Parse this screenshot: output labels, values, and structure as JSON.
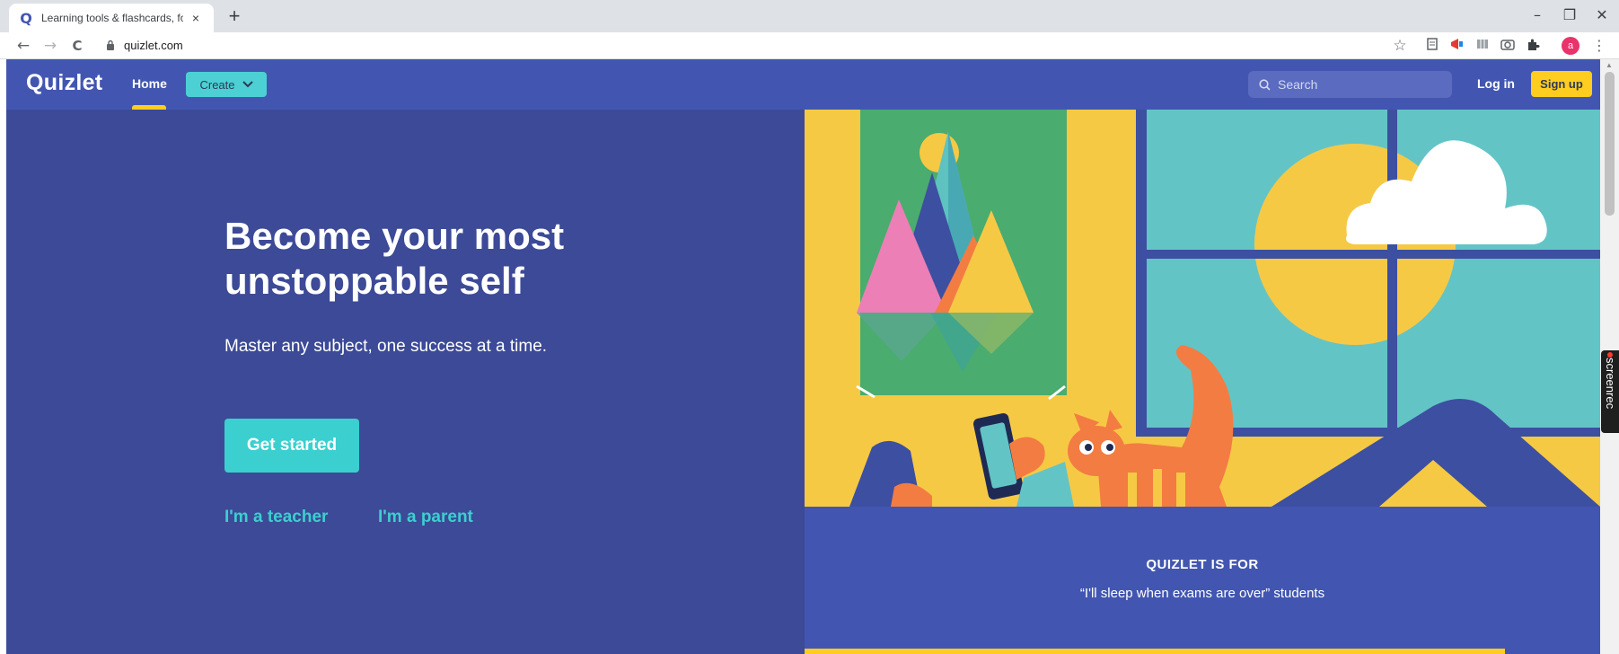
{
  "browser": {
    "tab_title": "Learning tools & flashcards, for free",
    "tab_favicon": "Q",
    "tab_close": "×",
    "new_tab": "+",
    "url": "quizlet.com",
    "back": "←",
    "forward": "→",
    "reload": "C",
    "minimize": "–",
    "restore": "❐",
    "close": "✕",
    "star": "☆",
    "menu": "⋮",
    "profile_initial": "a"
  },
  "header": {
    "logo": "Quizlet",
    "home": "Home",
    "create": "Create",
    "search_placeholder": "Search",
    "login": "Log in",
    "signup": "Sign up"
  },
  "hero": {
    "title": "Become your most unstoppable self",
    "subtitle": "Master any subject, one success at a time.",
    "cta": "Get started",
    "link_teacher": "I'm a teacher",
    "link_parent": "I'm a parent"
  },
  "quizlet_for": {
    "title": "QUIZLET IS FOR",
    "quote": "“I'll sleep when exams are over” students"
  },
  "overlay": {
    "screenrec": "screenrec"
  },
  "colors": {
    "page_bg": "#3c4a97",
    "header_bg": "#4256b1",
    "accent_yellow": "#ffcd1f",
    "accent_teal": "#3ccfcf",
    "create_teal": "#4cd0d3"
  }
}
